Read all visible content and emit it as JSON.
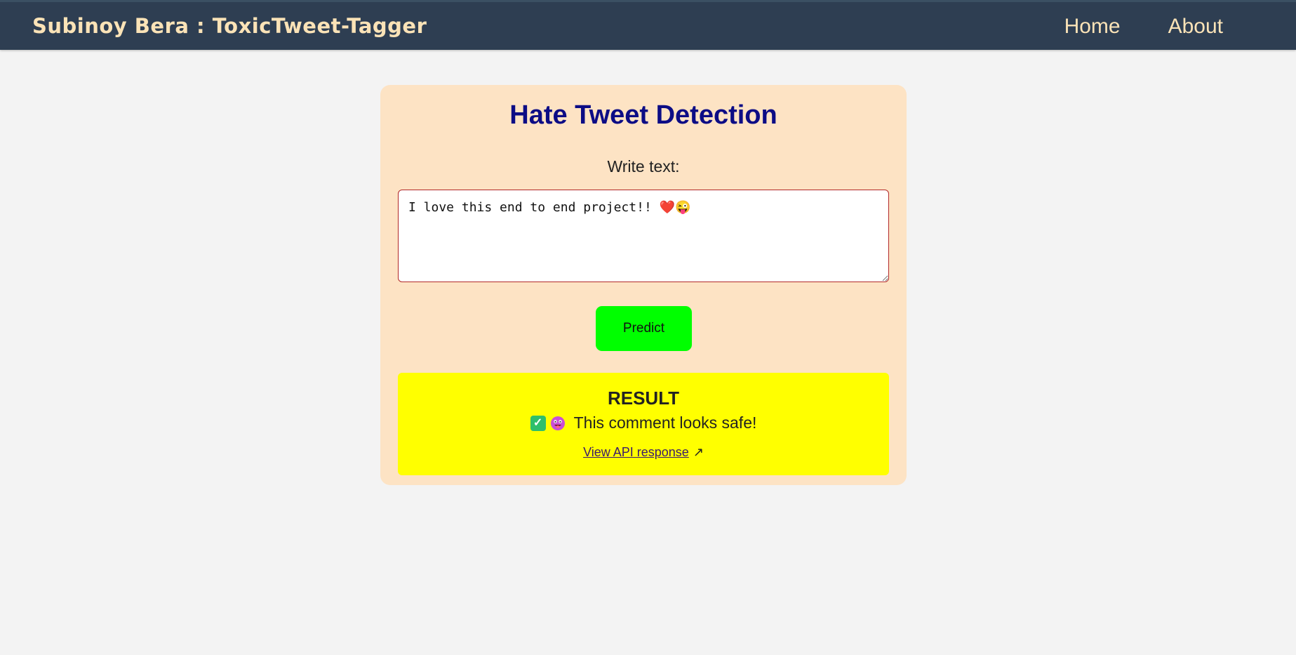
{
  "navbar": {
    "brand": "Subinoy Bera : ToxicTweet-Tagger",
    "links": [
      {
        "label": "Home"
      },
      {
        "label": "About"
      }
    ]
  },
  "main": {
    "title": "Hate Tweet Detection",
    "input_label": "Write text:",
    "input_value": "I love this end to end project!! ❤️😜",
    "predict_label": "Predict"
  },
  "result": {
    "heading": "RESULT",
    "message": "This comment looks safe!",
    "api_link": "View API response",
    "api_link_icon": "↗",
    "status_icon": "check-mark-icon",
    "emoji_icon": "face-with-tongue-icon"
  },
  "colors": {
    "navbar_bg": "#2e3e52",
    "brand_text": "#fbe3b7",
    "card_bg": "#fde3c4",
    "title": "#0c0c85",
    "predict_button": "#00ff00",
    "result_bg": "#ffff00"
  }
}
